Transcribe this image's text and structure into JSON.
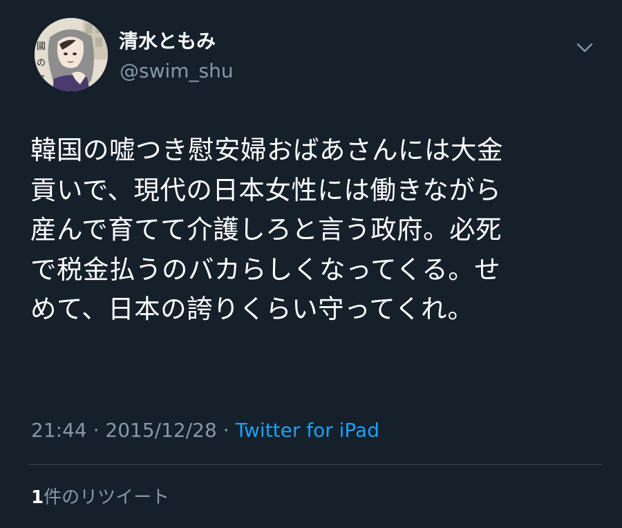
{
  "author": {
    "display_name": "清水ともみ",
    "handle": "@swim_shu",
    "avatar_glyphs": [
      "ノ",
      "國",
      "の",
      "名"
    ]
  },
  "tweet": {
    "text_lines": [
      "韓国の嘘つき慰安婦おばあさんには大金",
      "貢いで、現代の日本女性には働きながら",
      "産んで育てて介護しろと言う政府。必死",
      "で税金払うのバカらしくなってくる。せ",
      "めて、日本の誇りくらい守ってくれ。"
    ],
    "time": "21:44",
    "separator": " · ",
    "date": "2015/12/28",
    "source": "Twitter for iPad"
  },
  "stats": {
    "retweet_count": "1",
    "retweet_label": "件のリツイート"
  },
  "icons": {
    "menu": "chevron-down-icon"
  },
  "colors": {
    "background": "#15202b",
    "secondary_text": "#8899a6",
    "accent": "#1da1f2",
    "divider": "#38444d"
  }
}
